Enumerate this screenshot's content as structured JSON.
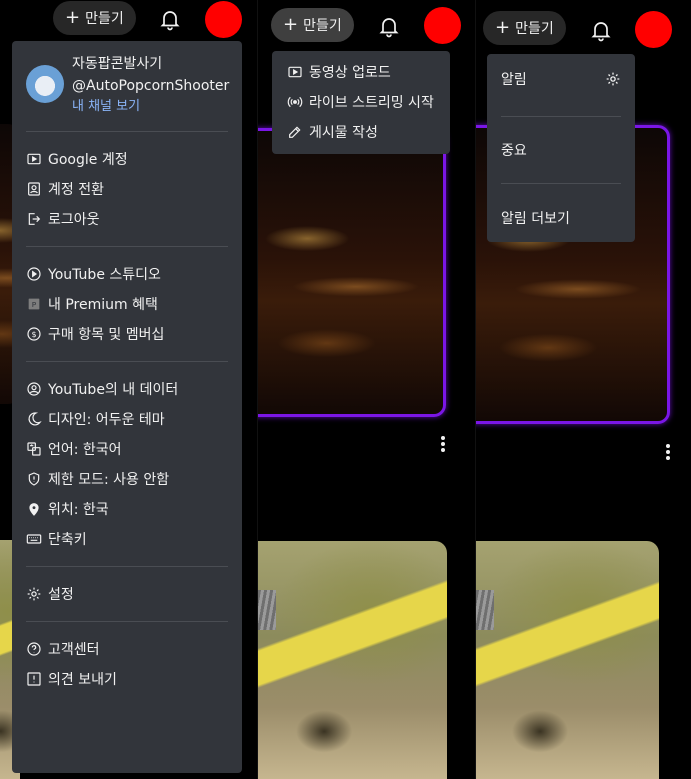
{
  "header": {
    "create_label": "만들기",
    "plus_symbol": "+"
  },
  "account_menu": {
    "user_name": "자동팝콘발사기",
    "handle": "@AutoPopcornShooter",
    "channel_link": "내 채널 보기",
    "groups": [
      [
        {
          "label": "Google 계정",
          "icon": "google-account-icon"
        },
        {
          "label": "계정 전환",
          "icon": "switch-account-icon"
        },
        {
          "label": "로그아웃",
          "icon": "sign-out-icon"
        }
      ],
      [
        {
          "label": "YouTube 스튜디오",
          "icon": "studio-icon"
        },
        {
          "label": "내 Premium 혜택",
          "icon": "premium-icon"
        },
        {
          "label": "구매 항목 및 멤버십",
          "icon": "dollar-icon"
        }
      ],
      [
        {
          "label": "YouTube의 내 데이터",
          "icon": "user-data-icon"
        },
        {
          "label": "디자인: 어두운 테마",
          "icon": "moon-icon"
        },
        {
          "label": "언어: 한국어",
          "icon": "translate-icon"
        },
        {
          "label": "제한 모드: 사용 안함",
          "icon": "shield-icon"
        },
        {
          "label": "위치: 한국",
          "icon": "location-icon"
        },
        {
          "label": "단축키",
          "icon": "keyboard-icon"
        }
      ],
      [
        {
          "label": "설정",
          "icon": "gear-icon"
        }
      ],
      [
        {
          "label": "고객센터",
          "icon": "help-icon"
        },
        {
          "label": "의견 보내기",
          "icon": "feedback-icon"
        }
      ]
    ]
  },
  "create_menu": {
    "items": [
      {
        "label": "동영상 업로드",
        "icon": "upload-video-icon"
      },
      {
        "label": "라이브 스트리밍 시작",
        "icon": "live-icon"
      },
      {
        "label": "게시물 작성",
        "icon": "edit-post-icon"
      }
    ]
  },
  "notification_menu": {
    "title": "알림",
    "important": "중요",
    "more": "알림 더보기"
  },
  "colors": {
    "menu_bg": "#32353b",
    "link": "#8ab4f8",
    "avatar_red": "#ff0000",
    "glow": "#7a16e6"
  }
}
